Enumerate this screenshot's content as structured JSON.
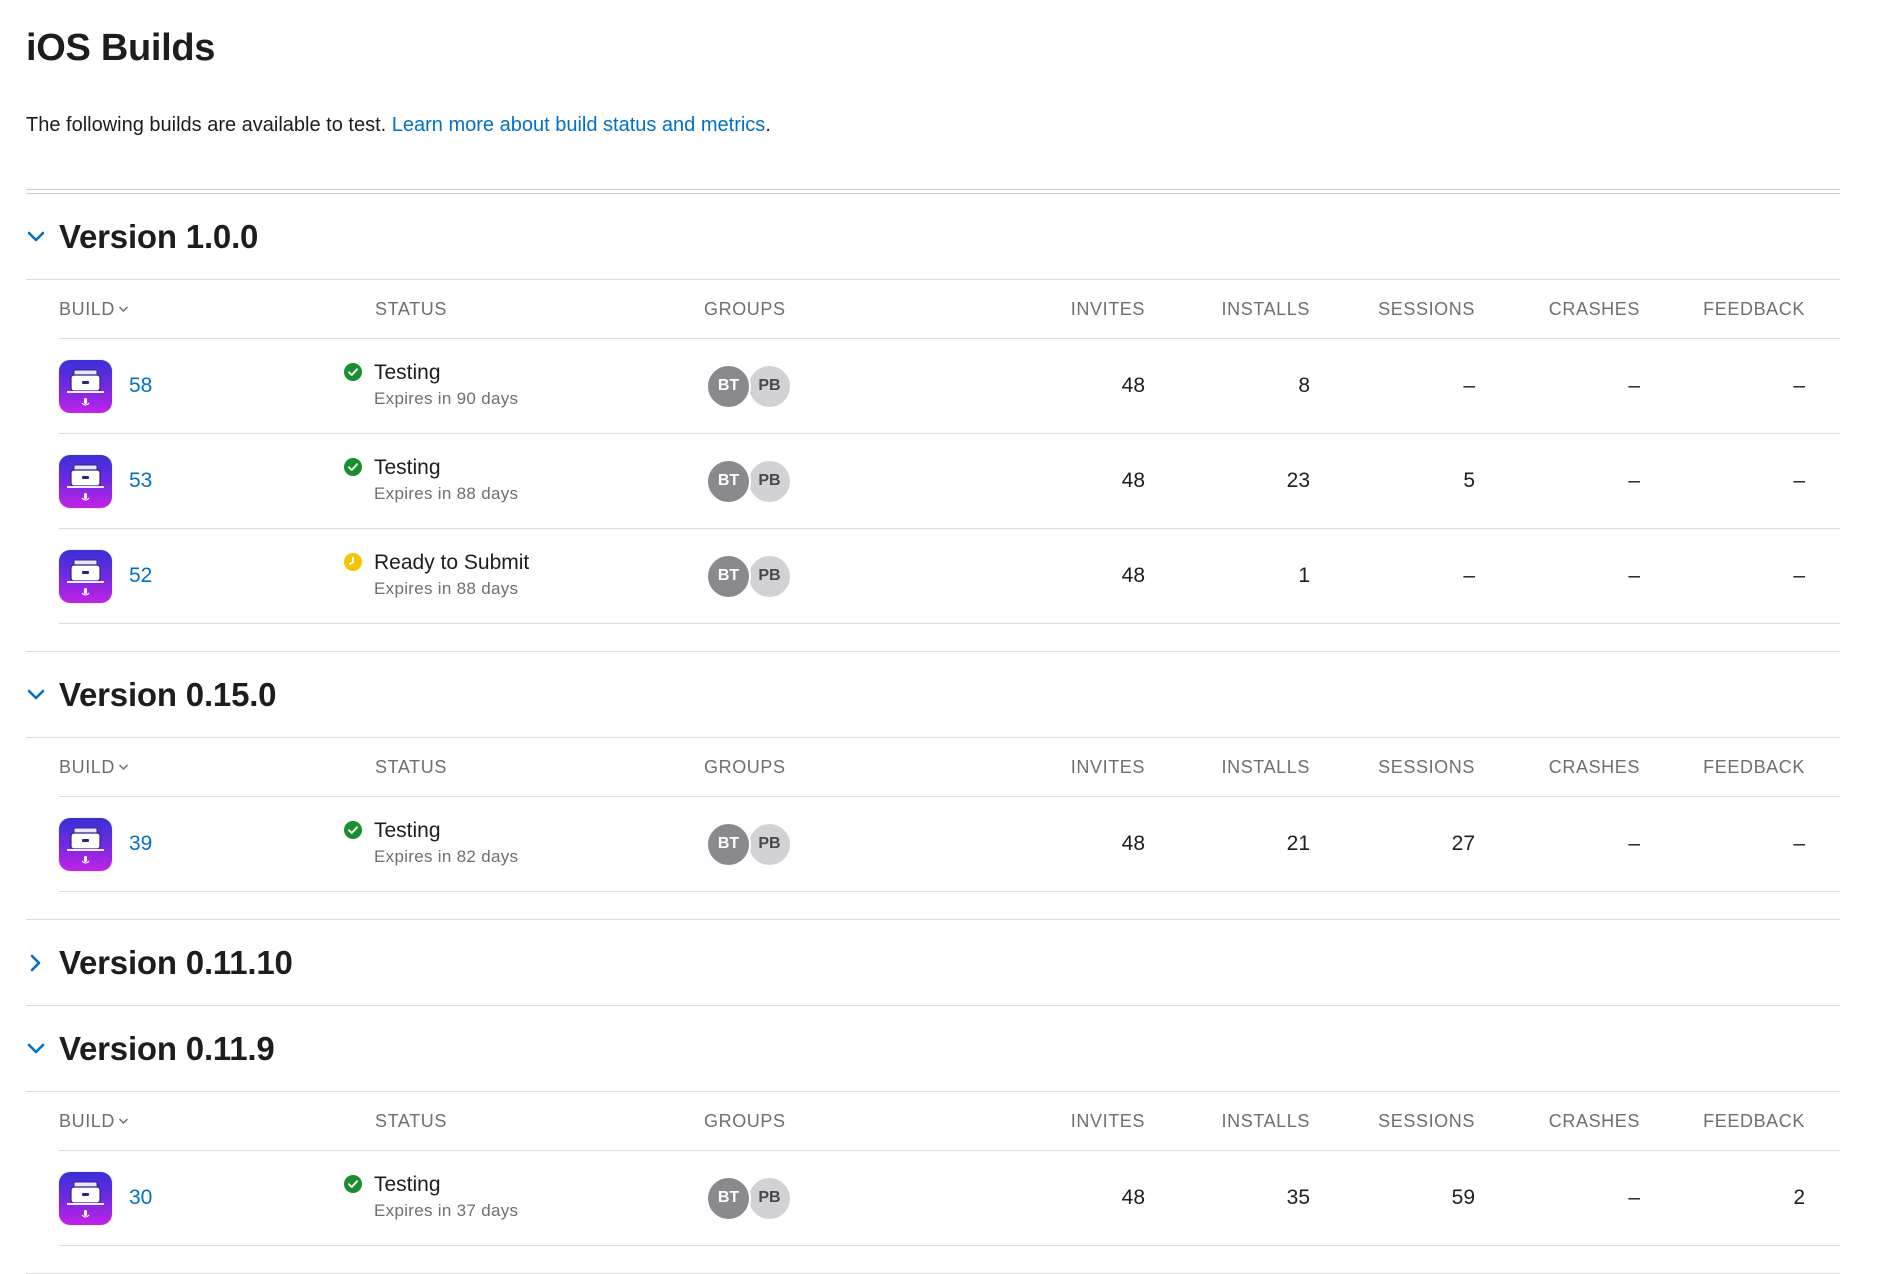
{
  "page": {
    "title": "iOS Builds",
    "subtitle_text": "The following builds are available to test. ",
    "subtitle_link": "Learn more about build status and metrics",
    "subtitle_end": "."
  },
  "columns": {
    "build": "BUILD",
    "status": "STATUS",
    "groups": "GROUPS",
    "invites": "INVITES",
    "installs": "INSTALLS",
    "sessions": "SESSIONS",
    "crashes": "CRASHES",
    "feedback": "FEEDBACK"
  },
  "colors": {
    "testing": "#1a8f2d",
    "ready": "#f5c400",
    "link": "#0070c9"
  },
  "versions": [
    {
      "title": "Version 1.0.0",
      "expanded": true,
      "builds": [
        {
          "build": "58",
          "status": "Testing",
          "status_kind": "testing",
          "expires": "Expires in 90 days",
          "groups": [
            "BT",
            "PB"
          ],
          "invites": "48",
          "installs": "8",
          "sessions": "–",
          "crashes": "–",
          "feedback": "–"
        },
        {
          "build": "53",
          "status": "Testing",
          "status_kind": "testing",
          "expires": "Expires in 88 days",
          "groups": [
            "BT",
            "PB"
          ],
          "invites": "48",
          "installs": "23",
          "sessions": "5",
          "crashes": "–",
          "feedback": "–"
        },
        {
          "build": "52",
          "status": "Ready to Submit",
          "status_kind": "ready",
          "expires": "Expires in 88 days",
          "groups": [
            "BT",
            "PB"
          ],
          "invites": "48",
          "installs": "1",
          "sessions": "–",
          "crashes": "–",
          "feedback": "–"
        }
      ]
    },
    {
      "title": "Version 0.15.0",
      "expanded": true,
      "builds": [
        {
          "build": "39",
          "status": "Testing",
          "status_kind": "testing",
          "expires": "Expires in 82 days",
          "groups": [
            "BT",
            "PB"
          ],
          "invites": "48",
          "installs": "21",
          "sessions": "27",
          "crashes": "–",
          "feedback": "–"
        }
      ]
    },
    {
      "title": "Version 0.11.10",
      "expanded": false,
      "builds": []
    },
    {
      "title": "Version 0.11.9",
      "expanded": true,
      "builds": [
        {
          "build": "30",
          "status": "Testing",
          "status_kind": "testing",
          "expires": "Expires in 37 days",
          "groups": [
            "BT",
            "PB"
          ],
          "invites": "48",
          "installs": "35",
          "sessions": "59",
          "crashes": "–",
          "feedback": "2"
        }
      ]
    }
  ]
}
